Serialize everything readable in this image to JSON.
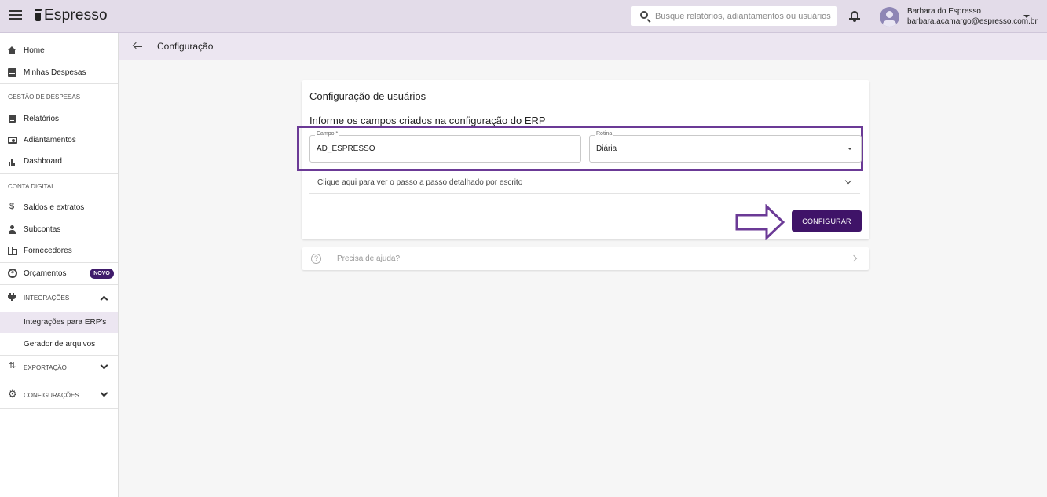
{
  "app": {
    "name": "Espresso"
  },
  "search": {
    "placeholder": "Busque relatórios, adiantamentos ou usuários"
  },
  "user": {
    "name": "Barbara do Espresso",
    "email": "barbara.acamargo@espresso.com.br"
  },
  "sidebar": {
    "items": [
      {
        "label": "Home",
        "icon": "home-icon"
      },
      {
        "label": "Minhas Despesas",
        "icon": "list-icon"
      }
    ],
    "section_gestao": "GESTÃO DE DESPESAS",
    "gestao_items": [
      {
        "label": "Relatórios",
        "icon": "document-icon"
      },
      {
        "label": "Adiantamentos",
        "icon": "money-icon"
      },
      {
        "label": "Dashboard",
        "icon": "chart-icon"
      }
    ],
    "section_conta": "CONTA DIGITAL",
    "conta_items": [
      {
        "label": "Saldos e extratos",
        "icon": "dollar-icon"
      },
      {
        "label": "Subcontas",
        "icon": "person-icon"
      },
      {
        "label": "Fornecedores",
        "icon": "building-icon"
      },
      {
        "label": "Orçamentos",
        "icon": "budget-icon",
        "badge": "NOVO"
      }
    ],
    "integracoes": {
      "label": "INTEGRAÇÕES",
      "icon": "plug-icon",
      "children": [
        "Integrações para ERP's",
        "Gerador de arquivos"
      ]
    },
    "exportacao": {
      "label": "EXPORTAÇÃO",
      "icon": "swap-icon"
    },
    "configuracoes": {
      "label": "CONFIGURAÇÕES",
      "icon": "gear-icon"
    }
  },
  "page": {
    "title": "Configuração"
  },
  "card": {
    "title": "Configuração de usuários",
    "subtitle": "Informe os campos criados na configuração do ERP",
    "field_campo": {
      "label": "Campo *",
      "value": "AD_ESPRESSO"
    },
    "field_rotina": {
      "label": "Rotina",
      "value": "Diária"
    },
    "accordion": "Clique aqui para ver o passo a passo detalhado por escrito",
    "button": "CONFIGURAR"
  },
  "help": {
    "label": "Precisa de ajuda?"
  },
  "colors": {
    "topbar": "#e3dce9",
    "primary": "#3f1368",
    "highlight": "#6b3a96"
  }
}
